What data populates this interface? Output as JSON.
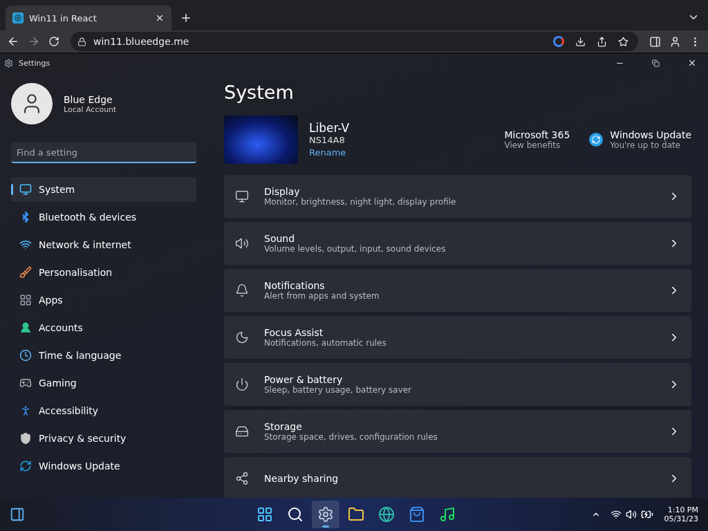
{
  "browser": {
    "tab": {
      "title": "Win11 in React"
    },
    "url": "win11.blueedge.me"
  },
  "window": {
    "title": "Settings"
  },
  "account": {
    "name": "Blue Edge",
    "type": "Local Account"
  },
  "search": {
    "placeholder": "Find a setting"
  },
  "nav": [
    {
      "label": "System",
      "kind": "system",
      "selected": true
    },
    {
      "label": "Bluetooth & devices",
      "kind": "bluetooth",
      "selected": false
    },
    {
      "label": "Network & internet",
      "kind": "network",
      "selected": false
    },
    {
      "label": "Personalisation",
      "kind": "brush",
      "selected": false
    },
    {
      "label": "Apps",
      "kind": "apps",
      "selected": false
    },
    {
      "label": "Accounts",
      "kind": "accounts",
      "selected": false
    },
    {
      "label": "Time & language",
      "kind": "time",
      "selected": false
    },
    {
      "label": "Gaming",
      "kind": "gaming",
      "selected": false
    },
    {
      "label": "Accessibility",
      "kind": "accessibility",
      "selected": false
    },
    {
      "label": "Privacy & security",
      "kind": "privacy",
      "selected": false
    },
    {
      "label": "Windows Update",
      "kind": "update",
      "selected": false
    }
  ],
  "page": {
    "title": "System"
  },
  "device": {
    "name": "Liber-V",
    "model": "NS14A8",
    "rename": "Rename"
  },
  "quick_links": [
    {
      "title": "Microsoft 365",
      "subtitle": "View benefits",
      "kind": "plain"
    },
    {
      "title": "Windows Update",
      "subtitle": "You're up to date",
      "kind": "update"
    }
  ],
  "cards": [
    {
      "title": "Display",
      "subtitle": "Monitor, brightness, night light, display profile",
      "kind": "display"
    },
    {
      "title": "Sound",
      "subtitle": "Volume levels, output, input, sound devices",
      "kind": "sound"
    },
    {
      "title": "Notifications",
      "subtitle": "Alert from apps and system",
      "kind": "notifications"
    },
    {
      "title": "Focus Assist",
      "subtitle": "Notifications, automatic rules",
      "kind": "focus"
    },
    {
      "title": "Power & battery",
      "subtitle": "Sleep, battery usage, battery saver",
      "kind": "power"
    },
    {
      "title": "Storage",
      "subtitle": "Storage space, drives, configuration rules",
      "kind": "storage"
    },
    {
      "title": "Nearby sharing",
      "kind": "share"
    }
  ],
  "taskbar": {
    "apps": [
      {
        "kind": "start",
        "selected": false
      },
      {
        "kind": "search",
        "selected": false
      },
      {
        "kind": "settings",
        "selected": true
      },
      {
        "kind": "explorer",
        "selected": false
      },
      {
        "kind": "edge",
        "selected": false
      },
      {
        "kind": "store",
        "selected": false
      },
      {
        "kind": "spotify",
        "selected": false
      }
    ],
    "time": "1:10 PM",
    "date": "05/31/23"
  }
}
